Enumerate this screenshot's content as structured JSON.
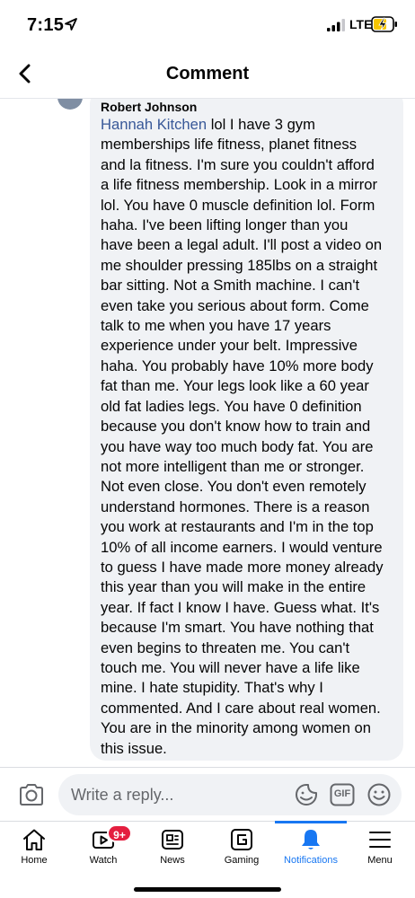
{
  "status_bar": {
    "time": "7:15",
    "network": "LTE",
    "icons": [
      "location-arrow-icon",
      "cellular-signal-icon",
      "battery-charging-icon"
    ]
  },
  "header": {
    "title": "Comment",
    "back_icon": "chevron-left-icon"
  },
  "comment": {
    "author": "Robert Johnson",
    "mention": "Hannah Kitchen",
    "text_lines": [
      " lol I have 3 gym",
      "memberships life fitness, planet fitness",
      "and la fitness. I'm sure you couldn't afford",
      "a life fitness membership. Look in a mirror",
      "lol. You have 0 muscle definition lol. Form",
      "haha. I've been lifting longer than you",
      "have been a legal adult. I'll post a video on",
      "me shoulder pressing 185lbs on a straight",
      "bar sitting. Not a Smith machine. I can't",
      "even take you serious about form. Come",
      "talk to me when you have 17 years",
      "experience under your belt. Impressive",
      "haha. You probably have 10% more body",
      "fat than me. Your legs look like a 60 year",
      "old fat ladies legs. You have 0 definition",
      "because you don't know how to train and",
      "you have way too much body fat. You are",
      "not more intelligent than me or stronger.",
      "Not even close. You don't even remotely",
      "understand hormones. There is a reason",
      "you work at restaurants and I'm in the top",
      "10% of all income earners. I would venture",
      "to guess I have made more money already",
      "this year than you will make in the entire",
      "year. If fact I know I have. Guess what. It's",
      "because I'm smart. You have nothing that",
      "even begins to threaten me. You can't",
      "touch me. You will never have a life like",
      "mine. I hate stupidity. That's why I",
      "commented. And I care about real women.",
      "You are in the minority among women on",
      "this issue."
    ],
    "colors": {
      "mention": "#385898",
      "bubble": "#f0f2f5"
    }
  },
  "reply_bar": {
    "placeholder": "Write a reply...",
    "gif_label": "GIF",
    "icons": [
      "camera-icon",
      "sticker-icon",
      "gif-icon",
      "emoji-icon"
    ]
  },
  "tab_bar": {
    "tabs": [
      {
        "label": "Home",
        "icon": "home-icon"
      },
      {
        "label": "Watch",
        "icon": "watch-icon",
        "badge": "9+"
      },
      {
        "label": "News",
        "icon": "news-icon"
      },
      {
        "label": "Gaming",
        "icon": "gaming-icon"
      },
      {
        "label": "Notifications",
        "icon": "bell-icon",
        "active": true
      },
      {
        "label": "Menu",
        "icon": "menu-icon"
      }
    ],
    "colors": {
      "active": "#1877f2",
      "badge": "#e41e3f"
    }
  }
}
